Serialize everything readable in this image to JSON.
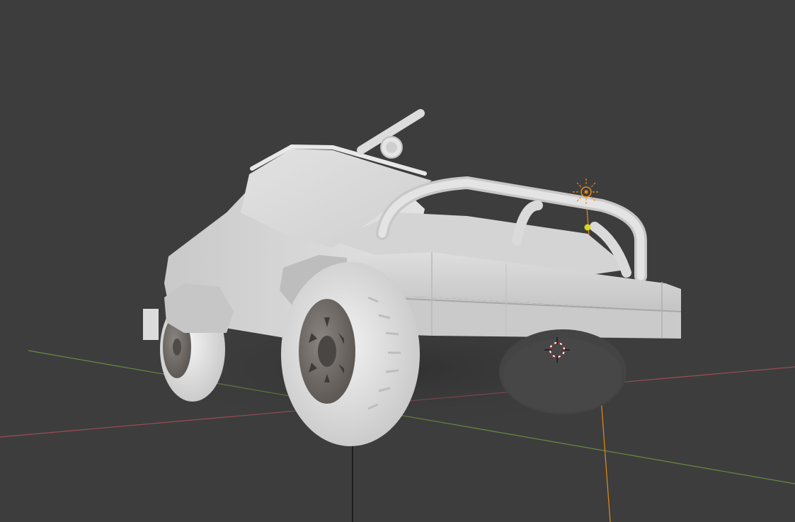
{
  "viewport": {
    "background_color": "#3d3d3d",
    "grid_floor": true
  },
  "axes": {
    "x_axis_color": "#9a4d58",
    "y_axis_color": "#6b8a3f",
    "z_axis_color": "#e88a1a"
  },
  "scene_objects": {
    "vehicle": "pickup-truck",
    "vehicle_color": "#d9d9d9",
    "tire_color": "#e6e6e6",
    "rim_color": "#6e6a66"
  },
  "light": {
    "type": "point-light",
    "color": "#e88a1a",
    "selected_dot_color": "#d8d818"
  },
  "cursor_3d": {
    "color_a": "#c8202a",
    "color_b": "#ffffff"
  }
}
